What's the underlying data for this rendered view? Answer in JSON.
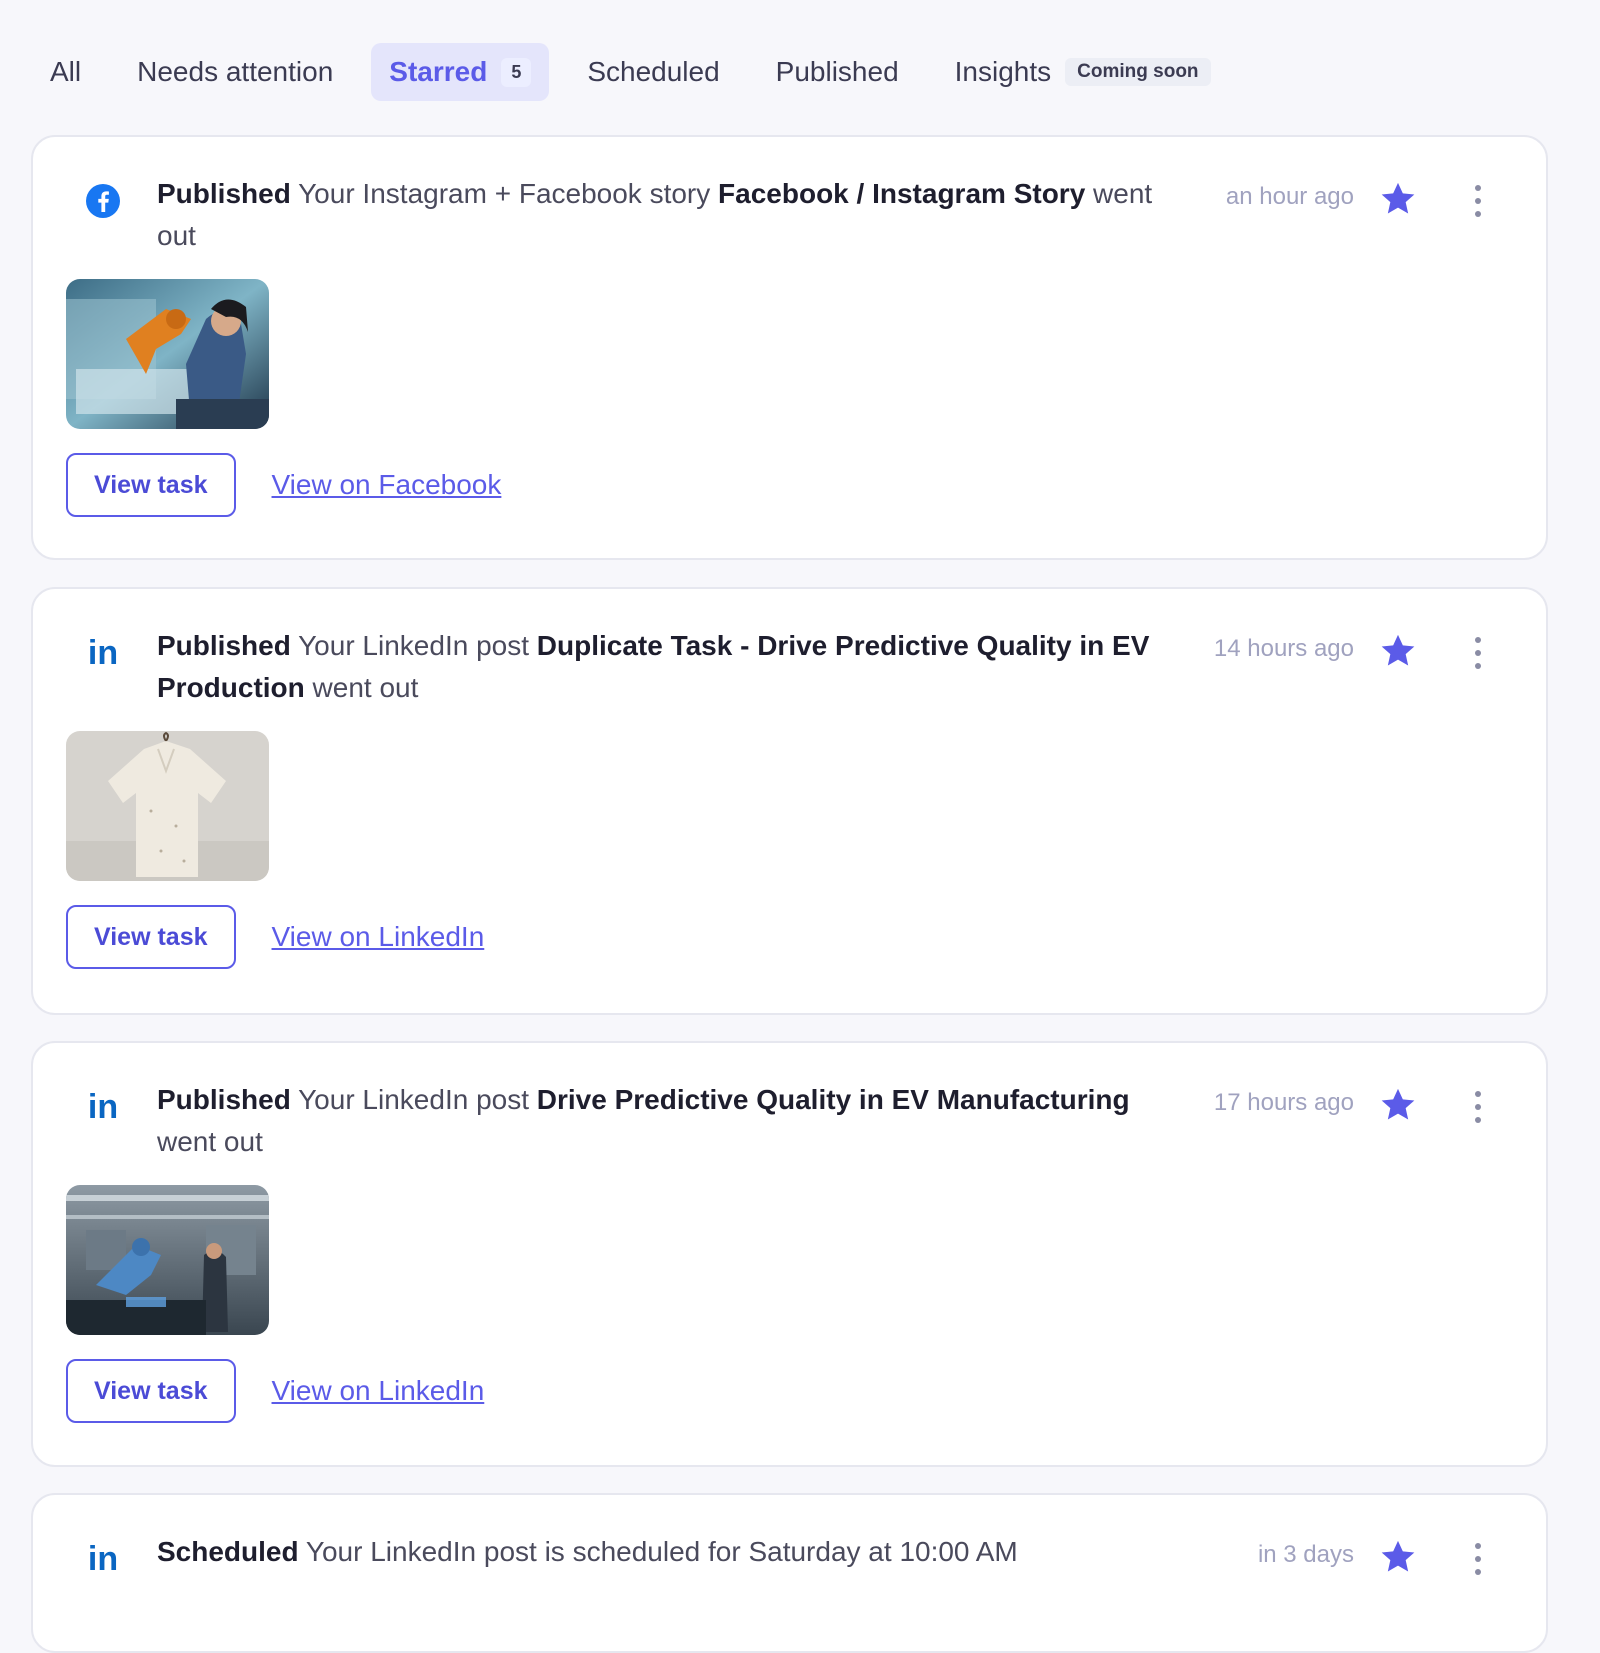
{
  "tabs": [
    {
      "label": "All"
    },
    {
      "label": "Needs attention"
    },
    {
      "label": "Starred",
      "count": "5"
    },
    {
      "label": "Scheduled"
    },
    {
      "label": "Published"
    },
    {
      "label": "Insights",
      "badge": "Coming soon"
    }
  ],
  "active_tab": "Starred",
  "colors": {
    "accent": "#5b5be8",
    "active_tab_bg": "#e4e5fb",
    "facebook": "#1877f2",
    "linkedin": "#0a66c2",
    "timestamp": "#a0a2bf"
  },
  "cards": [
    {
      "platform_icon": "facebook-icon",
      "status": "Published",
      "text1": "Your Instagram + Facebook story",
      "title": "Facebook / Instagram Story",
      "text2": "went out",
      "time": "an hour ago",
      "starred": true,
      "thumbnail": "factory-worker-robot-arm-image",
      "view_task": "View task",
      "view_link": "View on Facebook"
    },
    {
      "platform_icon": "linkedin-icon",
      "status": "Published",
      "text1": "Your LinkedIn post",
      "title": "Duplicate Task - Drive Predictive Quality in EV Production",
      "text2": "went out",
      "time": "14 hours ago",
      "starred": true,
      "thumbnail": "white-shirt-on-hanger-image",
      "view_task": "View task",
      "view_link": "View on LinkedIn"
    },
    {
      "platform_icon": "linkedin-icon",
      "status": "Published",
      "text1": "Your LinkedIn post",
      "title": "Drive Predictive Quality in EV Manufacturing",
      "text2": "went out",
      "time": "17 hours ago",
      "starred": true,
      "thumbnail": "ev-factory-robot-image",
      "view_task": "View task",
      "view_link": "View on LinkedIn"
    },
    {
      "platform_icon": "linkedin-icon",
      "status": "Scheduled",
      "text1": "Your LinkedIn post is scheduled for Saturday at 10:00 AM",
      "time": "in 3 days",
      "starred": true
    }
  ]
}
